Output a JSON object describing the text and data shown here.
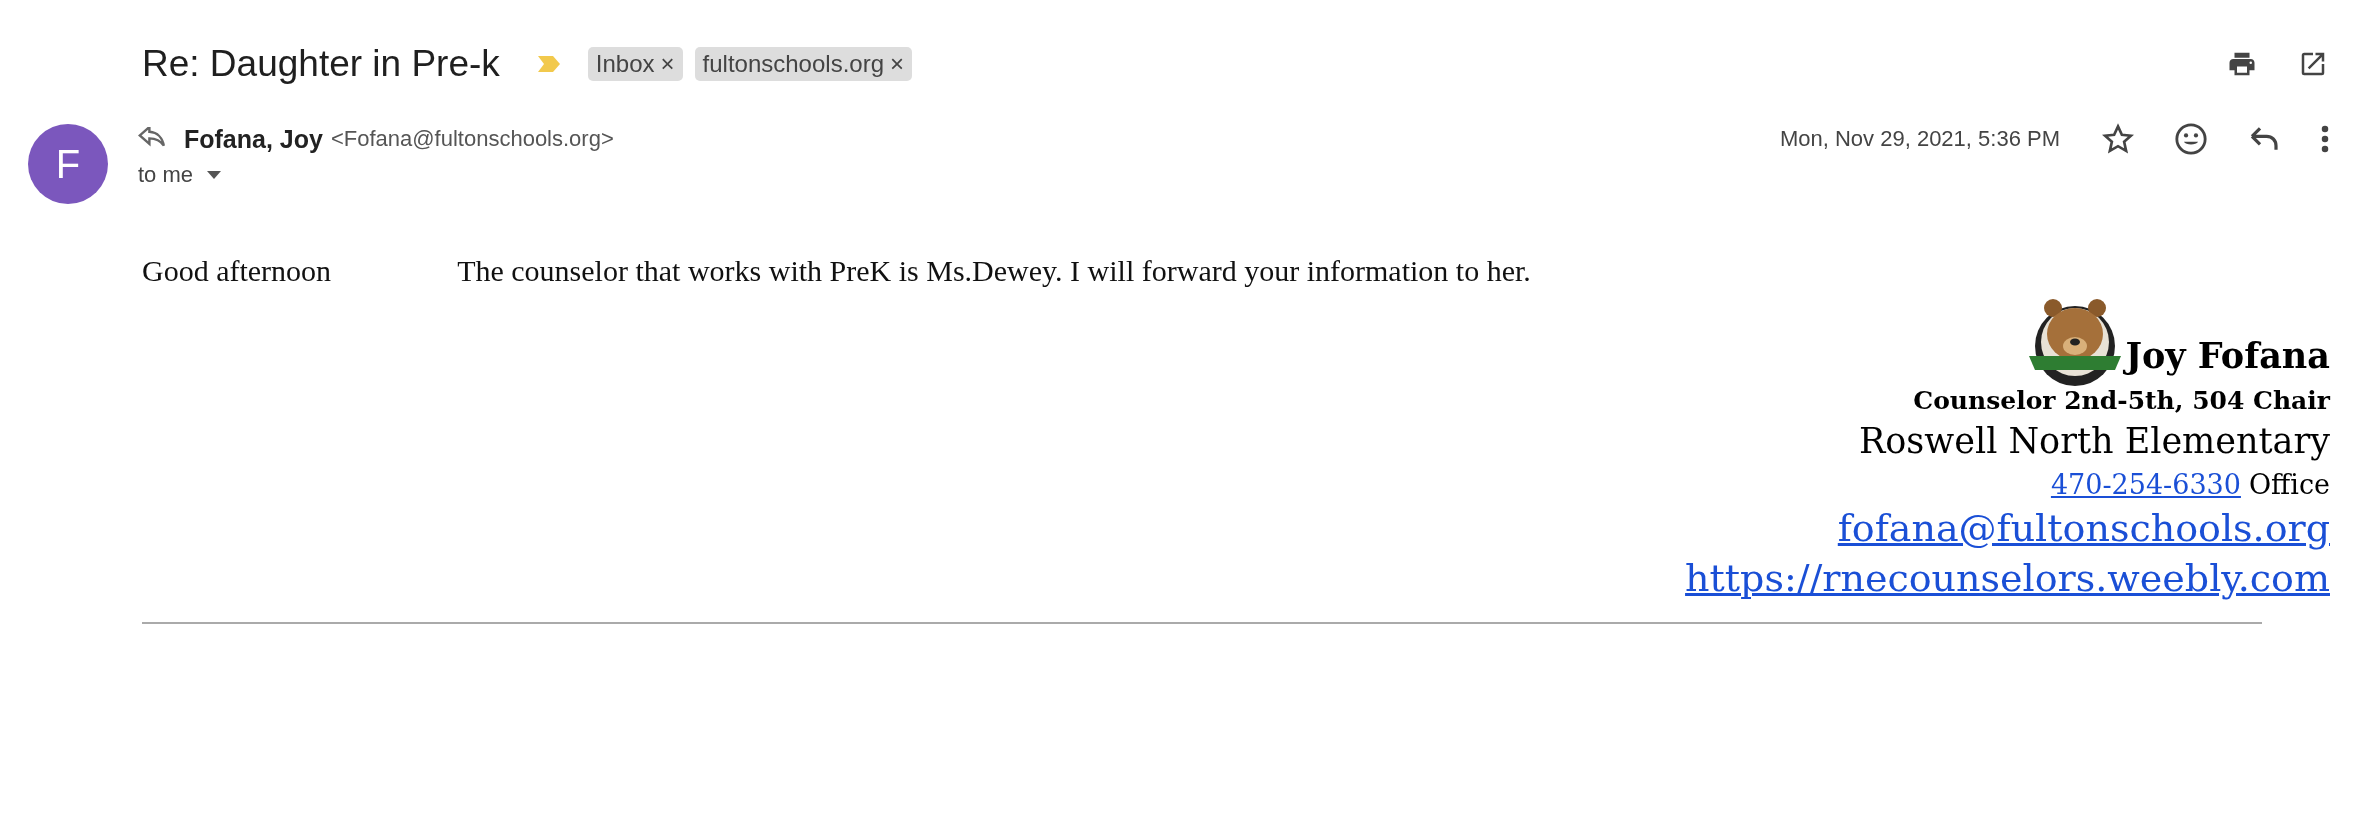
{
  "subject": "Re: Daughter in Pre-k",
  "important": true,
  "labels": [
    {
      "text": "Inbox",
      "close": "×"
    },
    {
      "text": "fultonschools.org",
      "close": "×"
    }
  ],
  "sender": {
    "initial": "F",
    "name": "Fofana, Joy",
    "email": "<Fofana@fultonschools.org>",
    "recipient": "to me",
    "date": "Mon, Nov 29, 2021, 5:36 PM",
    "starred": false
  },
  "body": {
    "greeting": "Good afternoon",
    "text": "The counselor that works with PreK is Ms.Dewey. I will forward your information to her."
  },
  "signature": {
    "name": "Joy Fofana",
    "role": "Counselor 2nd-5th, 504 Chair",
    "school": "Roswell North Elementary",
    "phone": "470-254-6330",
    "phone_label": "Office",
    "email": "fofana@fultonschools.org",
    "website": "https://rnecounselors.weebly.com"
  }
}
